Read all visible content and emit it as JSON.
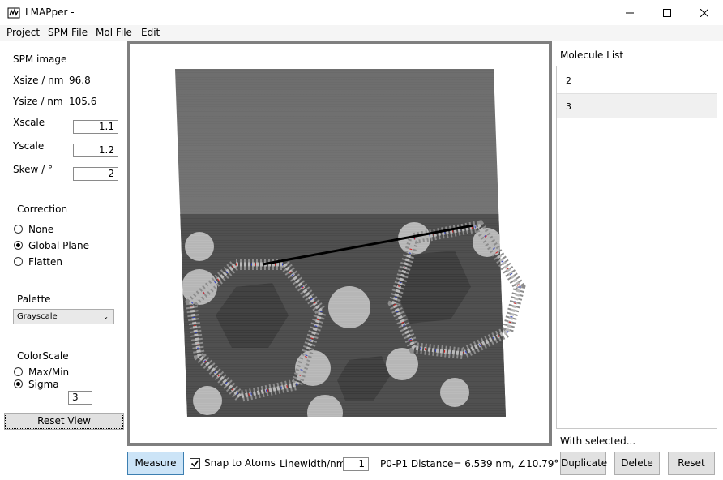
{
  "window": {
    "title": "LMAPper -"
  },
  "menu": [
    {
      "label": "Project",
      "key": "P"
    },
    {
      "label": "SPM File",
      "key": "S"
    },
    {
      "label": "Mol File",
      "key": "M"
    },
    {
      "label": "Edit",
      "key": "E"
    }
  ],
  "spm": {
    "heading": "SPM image",
    "xsize_label": "Xsize / nm",
    "xsize_value": "96.8",
    "ysize_label": "Ysize / nm",
    "ysize_value": "105.6",
    "xscale_label": "Xscale",
    "xscale_value": "1.1",
    "yscale_label": "Yscale",
    "yscale_value": "1.2",
    "skew_label": "Skew / °",
    "skew_value": "2"
  },
  "correction": {
    "heading": "Correction",
    "options": [
      "None",
      "Global Plane",
      "Flatten"
    ],
    "selected": "Global Plane"
  },
  "palette": {
    "heading": "Palette",
    "selected": "Grayscale"
  },
  "colorscale": {
    "heading": "ColorScale",
    "options": [
      "Max/Min",
      "Sigma"
    ],
    "selected": "Sigma",
    "sigma_value": "3"
  },
  "reset_view_label": "Reset View",
  "bottom": {
    "measure_label": "Measure",
    "snap_label": "Snap to Atoms",
    "snap_checked": true,
    "linewidth_label": "Linewidth/nm",
    "linewidth_value": "1",
    "distance_text": "P0-P1 Distance= 6.539 nm, ∠10.79°"
  },
  "molecules": {
    "heading": "Molecule List",
    "items": [
      "2",
      "3"
    ],
    "selected": "3",
    "with_selected_label": "With selected...",
    "duplicate_label": "Duplicate",
    "delete_label": "Delete",
    "reset_label": "Reset"
  }
}
